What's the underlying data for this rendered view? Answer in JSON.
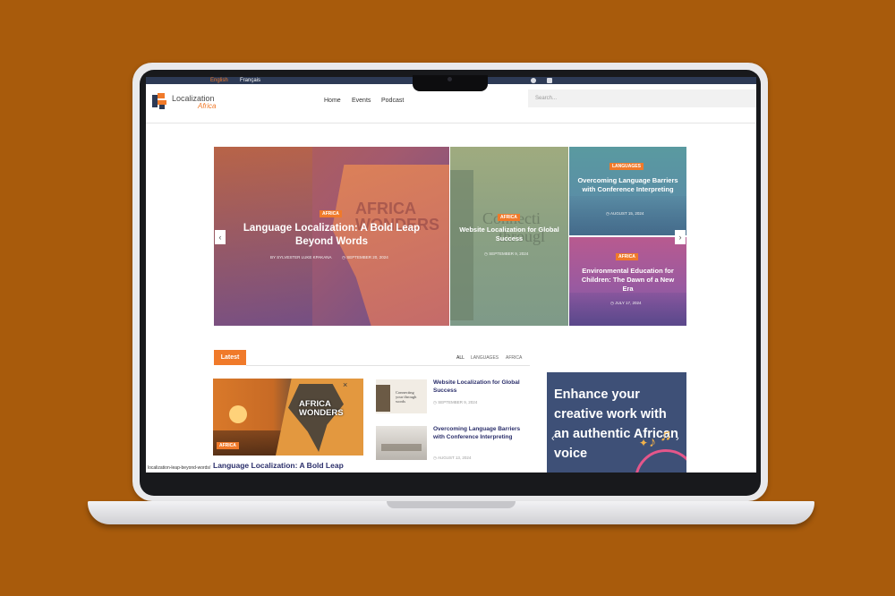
{
  "topbar": {
    "lang_english": "English",
    "lang_french": "Français"
  },
  "header": {
    "logo_line1": "Localization",
    "logo_line2": "Africa",
    "nav": [
      "Home",
      "Events",
      "Podcast"
    ],
    "search_placeholder": "Search..."
  },
  "slider": {
    "main": {
      "tag": "AFRICA",
      "title": "Language Localization: A Bold Leap Beyond Words",
      "author": "BY SYLVESTER LUKE KPAKANA",
      "date": "SEPTEMBER 20, 2024",
      "image_text_1": "AFRICA",
      "image_text_2": "WONDERS"
    },
    "middle": {
      "tag": "AFRICA",
      "title": "Website Localization for Global Success",
      "date": "SEPTEMBER 9, 2024",
      "image_text_1": "Connecti",
      "image_text_2": "througl"
    },
    "right_top": {
      "tag": "LANGUAGES",
      "title": "Overcoming Language Barriers with Conference Interpreting",
      "date": "AUGUST 15, 2024"
    },
    "right_bottom": {
      "tag": "AFRICA",
      "title": "Environmental Education for Children: The Dawn of a New Era",
      "date": "JULY 17, 2024"
    },
    "prev_arrow": "‹",
    "next_arrow": "›"
  },
  "latest": {
    "label": "Latest",
    "filters": [
      "ALL",
      "LANGUAGES",
      "AFRICA"
    ],
    "featured": {
      "tag": "AFRICA",
      "title": "Language Localization: A Bold Leap",
      "image_text_1": "AFRICA",
      "image_text_2": "WONDERS"
    },
    "items": [
      {
        "title": "Website Localization for Global Success",
        "date": "SEPTEMBER 9, 2024",
        "thumb_text": "Connecting your through words"
      },
      {
        "title": "Overcoming Language Barriers with Conference Interpreting",
        "date": "AUGUST 13, 2024"
      }
    ]
  },
  "ad": {
    "text": "Enhance your creative work with an authentic African voice",
    "prev": "‹",
    "next": "›"
  },
  "status_url": "localization-leap-beyond-words/",
  "colors": {
    "accent": "#f07a2a",
    "navy_text": "#2b2f6b",
    "topbar": "#2d3a55",
    "background": "#a85b0c"
  }
}
